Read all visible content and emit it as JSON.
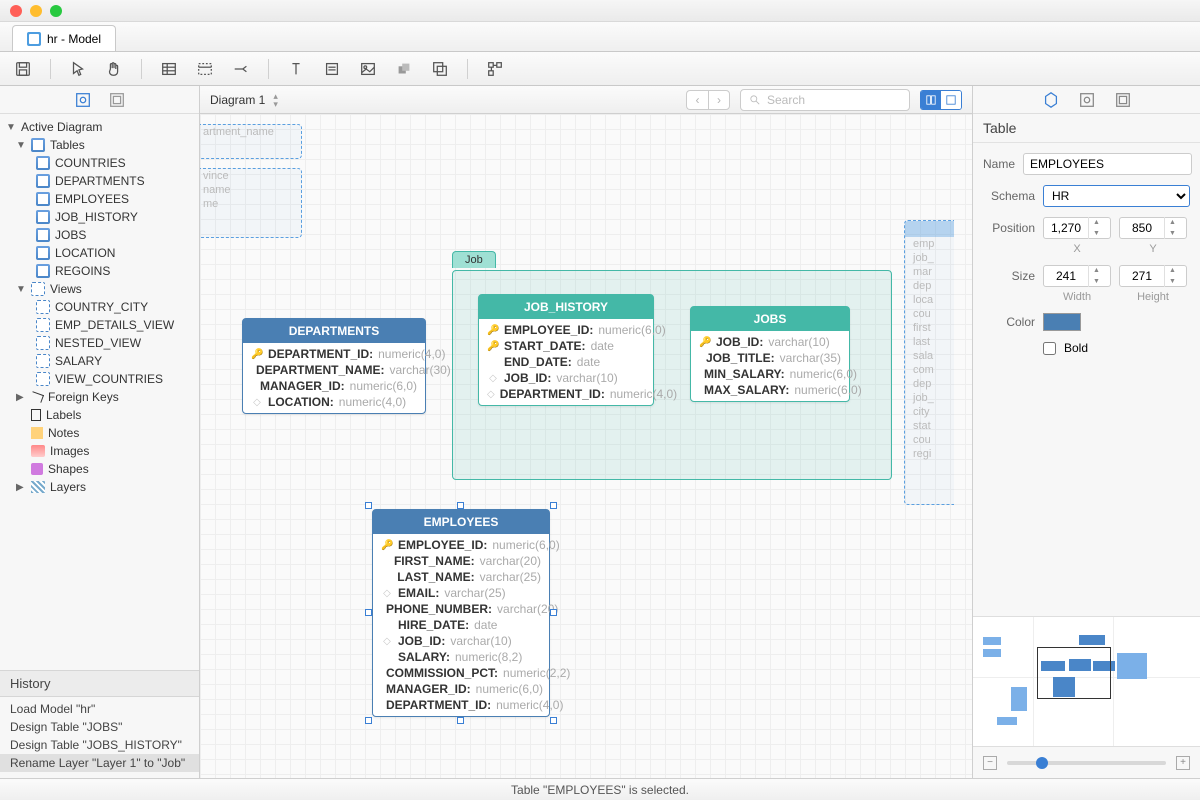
{
  "tab_title": "hr - Model",
  "sidebar": {
    "active_diagram": "Active Diagram",
    "tables_label": "Tables",
    "tables": [
      "COUNTRIES",
      "DEPARTMENTS",
      "EMPLOYEES",
      "JOB_HISTORY",
      "JOBS",
      "LOCATION",
      "REGOINS"
    ],
    "views_label": "Views",
    "views": [
      "COUNTRY_CITY",
      "EMP_DETAILS_VIEW",
      "NESTED_VIEW",
      "SALARY",
      "VIEW_COUNTRIES"
    ],
    "foreign_keys": "Foreign Keys",
    "labels": "Labels",
    "notes": "Notes",
    "images": "Images",
    "shapes": "Shapes",
    "layers": "Layers"
  },
  "history": {
    "title": "History",
    "items": [
      "Load Model \"hr\"",
      "Design Table \"JOBS\"",
      "Design Table \"JOBS_HISTORY\"",
      "Rename Layer \"Layer 1\" to \"Job\""
    ]
  },
  "canvas_toolbar": {
    "diagram_label": "Diagram 1",
    "search_placeholder": "Search"
  },
  "layer_job": "Job",
  "ghost_a": [
    "artment_name"
  ],
  "ghost_b": [
    "vince",
    "name",
    "me"
  ],
  "ghost_c": [
    "emp",
    "job_",
    "mar",
    "dep",
    "loca",
    "cou",
    "first",
    "last",
    "sala",
    "com",
    "dep",
    "job_",
    "city",
    "stat",
    "cou",
    "regi"
  ],
  "entities": {
    "departments": {
      "title": "DEPARTMENTS",
      "cols": [
        {
          "k": "key",
          "n": "DEPARTMENT_ID:",
          "t": "numeric(4,0)"
        },
        {
          "k": "",
          "n": "DEPARTMENT_NAME:",
          "t": "varchar(30)"
        },
        {
          "k": "",
          "n": "MANAGER_ID:",
          "t": "numeric(6,0)"
        },
        {
          "k": "dia",
          "n": "LOCATION:",
          "t": "numeric(4,0)"
        }
      ]
    },
    "job_history": {
      "title": "JOB_HISTORY",
      "cols": [
        {
          "k": "key",
          "n": "EMPLOYEE_ID:",
          "t": "numeric(6,0)"
        },
        {
          "k": "key",
          "n": "START_DATE:",
          "t": "date"
        },
        {
          "k": "",
          "n": "END_DATE:",
          "t": "date"
        },
        {
          "k": "dia",
          "n": "JOB_ID:",
          "t": "varchar(10)"
        },
        {
          "k": "dia",
          "n": "DEPARTMENT_ID:",
          "t": "numeric(4,0)"
        }
      ]
    },
    "jobs": {
      "title": "JOBS",
      "cols": [
        {
          "k": "key",
          "n": "JOB_ID:",
          "t": "varchar(10)"
        },
        {
          "k": "",
          "n": "JOB_TITLE:",
          "t": "varchar(35)"
        },
        {
          "k": "",
          "n": "MIN_SALARY:",
          "t": "numeric(6,0)"
        },
        {
          "k": "",
          "n": "MAX_SALARY:",
          "t": "numeric(6,0)"
        }
      ]
    },
    "employees": {
      "title": "EMPLOYEES",
      "cols": [
        {
          "k": "key",
          "n": "EMPLOYEE_ID:",
          "t": "numeric(6,0)"
        },
        {
          "k": "",
          "n": "FIRST_NAME:",
          "t": "varchar(20)"
        },
        {
          "k": "",
          "n": "LAST_NAME:",
          "t": "varchar(25)"
        },
        {
          "k": "dia",
          "n": "EMAIL:",
          "t": "varchar(25)"
        },
        {
          "k": "",
          "n": "PHONE_NUMBER:",
          "t": "varchar(20)"
        },
        {
          "k": "",
          "n": "HIRE_DATE:",
          "t": "date"
        },
        {
          "k": "dia",
          "n": "JOB_ID:",
          "t": "varchar(10)"
        },
        {
          "k": "",
          "n": "SALARY:",
          "t": "numeric(8,2)"
        },
        {
          "k": "",
          "n": "COMMISSION_PCT:",
          "t": "numeric(2,2)"
        },
        {
          "k": "",
          "n": "MANAGER_ID:",
          "t": "numeric(6,0)"
        },
        {
          "k": "",
          "n": "DEPARTMENT_ID:",
          "t": "numeric(4,0)"
        }
      ]
    }
  },
  "props": {
    "section": "Table",
    "name_label": "Name",
    "name_value": "EMPLOYEES",
    "schema_label": "Schema",
    "schema_value": "HR",
    "position_label": "Position",
    "pos_x": "1,270",
    "pos_y": "850",
    "x_label": "X",
    "y_label": "Y",
    "size_label": "Size",
    "size_w": "241",
    "size_h": "271",
    "w_label": "Width",
    "h_label": "Height",
    "color_label": "Color",
    "bold_label": "Bold"
  },
  "status": "Table \"EMPLOYEES\" is selected."
}
